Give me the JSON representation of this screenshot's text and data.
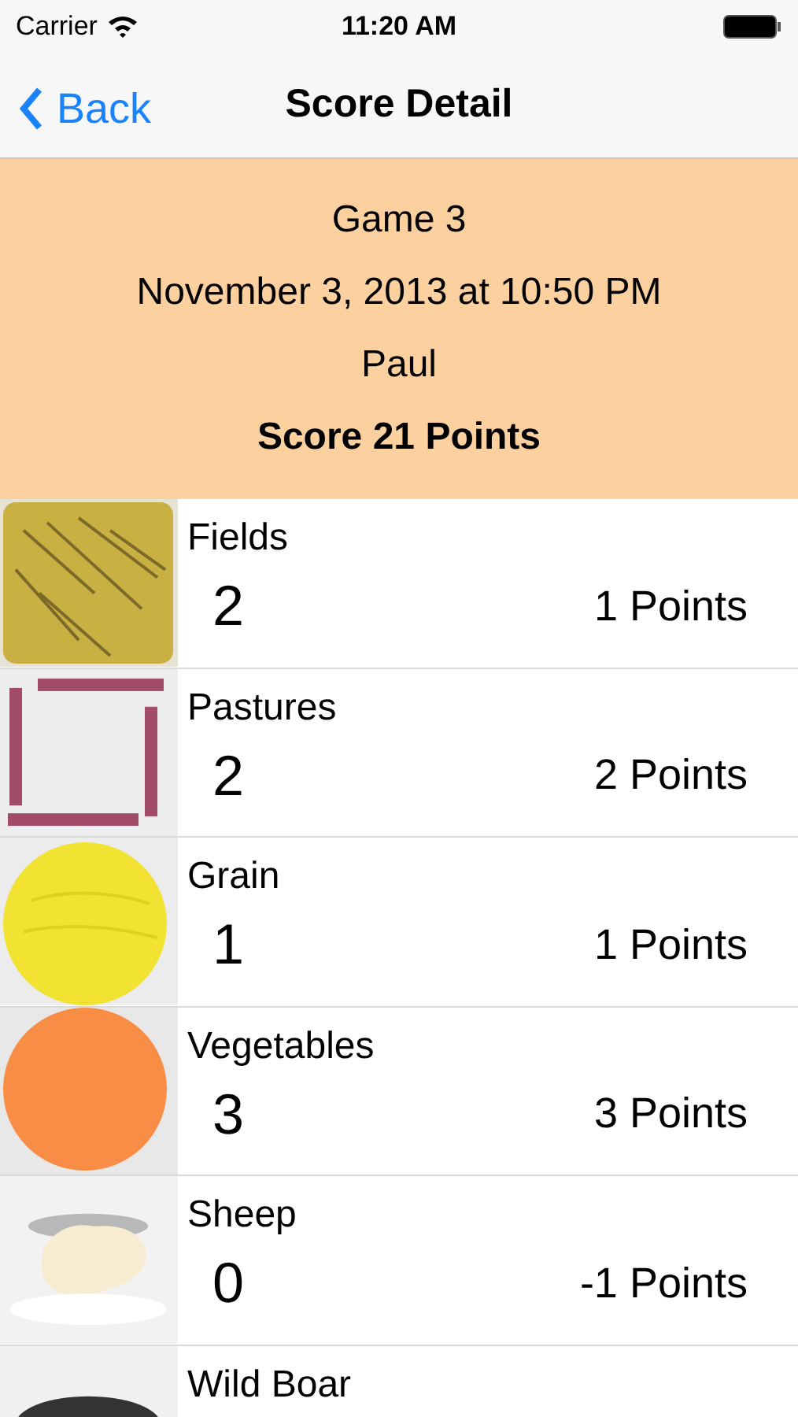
{
  "status_bar": {
    "carrier": "Carrier",
    "time": "11:20 AM"
  },
  "nav": {
    "back": "Back",
    "title": "Score Detail"
  },
  "header": {
    "game": "Game 3",
    "date": "November 3, 2013 at 10:50 PM",
    "player": "Paul",
    "score": "Score 21 Points"
  },
  "rows": [
    {
      "name": "Fields",
      "count": "2",
      "points": "1 Points"
    },
    {
      "name": "Pastures",
      "count": "2",
      "points": "2 Points"
    },
    {
      "name": "Grain",
      "count": "1",
      "points": "1 Points"
    },
    {
      "name": "Vegetables",
      "count": "3",
      "points": "3 Points"
    },
    {
      "name": "Sheep",
      "count": "0",
      "points": "-1 Points"
    },
    {
      "name": "Wild Boar"
    }
  ]
}
